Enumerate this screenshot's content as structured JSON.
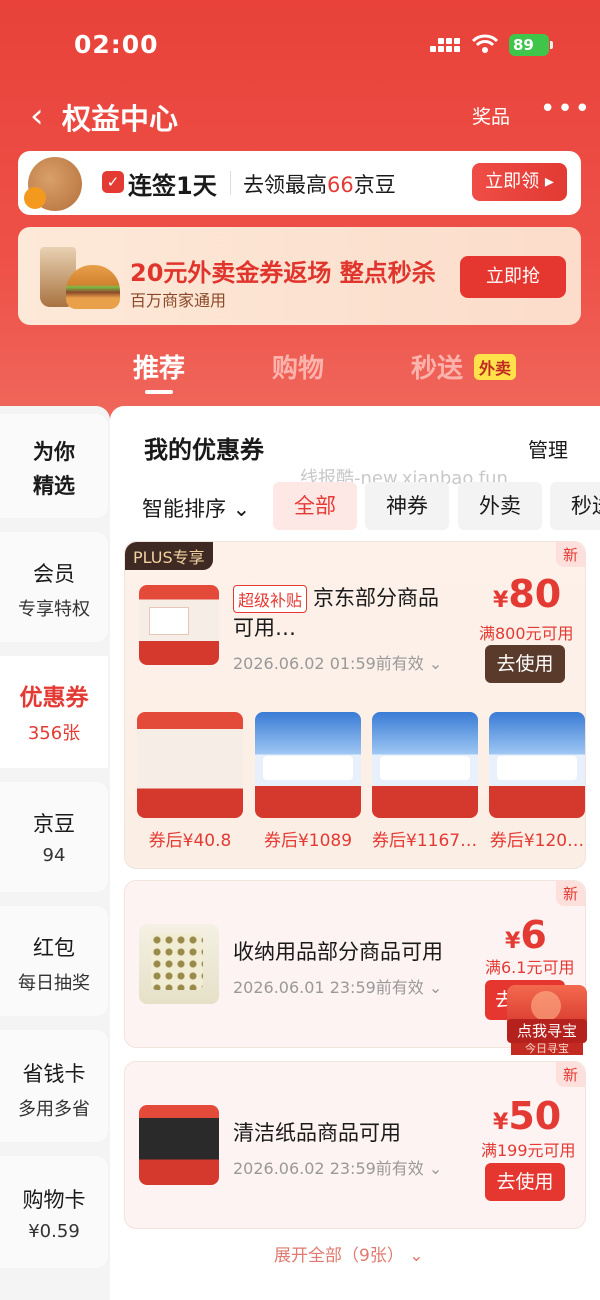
{
  "status": {
    "time": "02:00",
    "battery": "89"
  },
  "nav": {
    "back_icon": "chevron-left",
    "title": "权益中心",
    "prize": "奖品",
    "more": "•••"
  },
  "sign": {
    "check": "✓",
    "days": "连签1天",
    "desc_pre": "去领最高",
    "desc_num": "66",
    "desc_post": "京豆",
    "button": "立即领 ▸"
  },
  "promo": {
    "title": "20元外卖金券返场 整点秒杀",
    "subtitle": "百万商家通用",
    "button": "立即抢"
  },
  "tabs": [
    {
      "label": "推荐",
      "active": true
    },
    {
      "label": "购物"
    },
    {
      "label": "秒送",
      "badge": "外卖"
    }
  ],
  "sidebar": [
    {
      "line1": "为你",
      "line2": "精选"
    },
    {
      "line1": "会员",
      "line2": "专享特权"
    },
    {
      "line1": "优惠券",
      "line2": "356张",
      "active": true
    },
    {
      "line1": "京豆",
      "line2": "94"
    },
    {
      "line1": "红包",
      "line2": "每日抽奖"
    },
    {
      "line1": "省钱卡",
      "line2": "多用多省"
    },
    {
      "line1": "购物卡",
      "line2": "¥0.59"
    }
  ],
  "coupons_section": {
    "title": "我的优惠券",
    "manage": "管理",
    "watermark": "线报酷-new.xianbao.fun",
    "sort": "智能排序 ⌄",
    "filters": [
      "全部",
      "神券",
      "外卖",
      "秒送"
    ]
  },
  "coupons": [
    {
      "plus_tag": "PLUS专享",
      "new_tag": "新",
      "super_tag": "超级补贴",
      "name_line1": "京东部分商品",
      "name_line2": "可用…",
      "expiry": "2026.06.02 01:59前有效 ⌄",
      "currency": "¥",
      "amount": "80",
      "condition": "满800元可用",
      "button": "去使用",
      "products": [
        {
          "price": "券后¥40.8"
        },
        {
          "price": "券后¥1089"
        },
        {
          "price": "券后¥1167.…"
        },
        {
          "price": "券后¥120…"
        }
      ]
    },
    {
      "new_tag": "新",
      "name": "收纳用品部分商品可用",
      "expiry": "2026.06.01 23:59前有效 ⌄",
      "currency": "¥",
      "amount": "6",
      "condition": "满6.1元可用",
      "button": "去"
    },
    {
      "new_tag": "新",
      "name": "清洁纸品商品可用",
      "expiry": "2026.06.02 23:59前有效 ⌄",
      "currency": "¥",
      "amount": "50",
      "condition": "满199元可用",
      "button": "去使用"
    }
  ],
  "expand": "展开全部（9张） ⌄",
  "floater": {
    "label": "点我寻宝",
    "sub": "今日寻宝"
  },
  "colors": {
    "brand_red": "#e43a34",
    "header_bg": "#ee5148"
  }
}
